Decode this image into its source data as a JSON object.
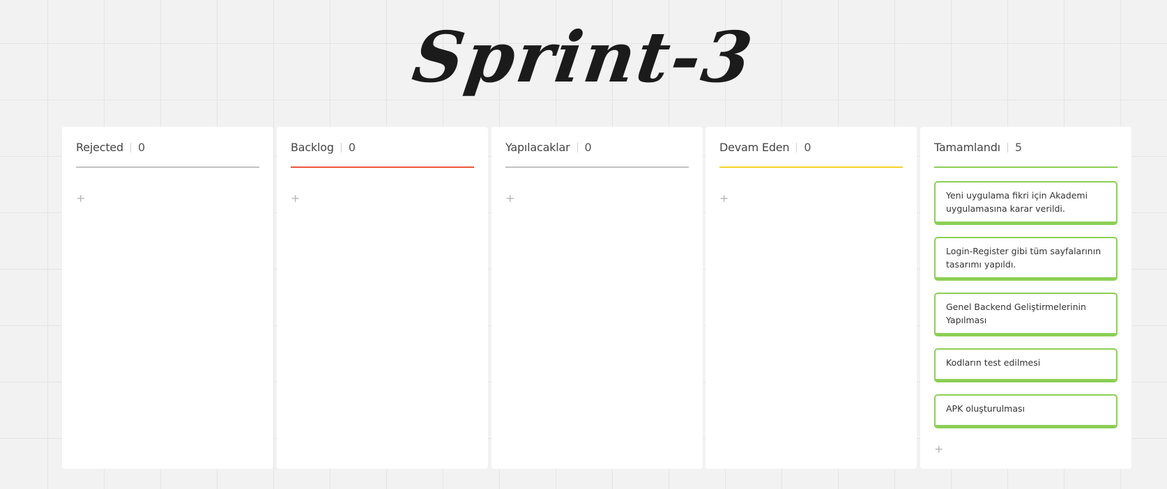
{
  "board": {
    "title": "Sprint-3"
  },
  "colors": {
    "rejected_line": "#c4c4c4",
    "backlog_line": "#ee5538",
    "todo_line": "#c4c4c4",
    "inprogress_line": "#f4d32a",
    "done_line": "#8bcf55",
    "card_border": "#8bcf55"
  },
  "columns": [
    {
      "title": "Rejected",
      "count": "0",
      "add_icon": "plus-icon",
      "add_glyph": "+"
    },
    {
      "title": "Backlog",
      "count": "0",
      "add_icon": "plus-icon",
      "add_glyph": "+"
    },
    {
      "title": "Yapılacaklar",
      "count": "0",
      "add_icon": "plus-icon",
      "add_glyph": "+"
    },
    {
      "title": "Devam Eden",
      "count": "0",
      "add_icon": "plus-icon",
      "add_glyph": "+"
    },
    {
      "title": "Tamamlandı",
      "count": "5",
      "add_icon": "plus-icon",
      "add_glyph": "+",
      "cards": [
        {
          "text": "Yeni uygulama fikri için Akademi uygulamasına karar verildi."
        },
        {
          "text": "Login-Register gibi tüm sayfalarının tasarımı yapıldı."
        },
        {
          "text": "Genel Backend Geliştirmelerinin Yapılması"
        },
        {
          "text": "Kodların test edilmesi"
        },
        {
          "text": "APK oluşturulması"
        }
      ]
    }
  ]
}
